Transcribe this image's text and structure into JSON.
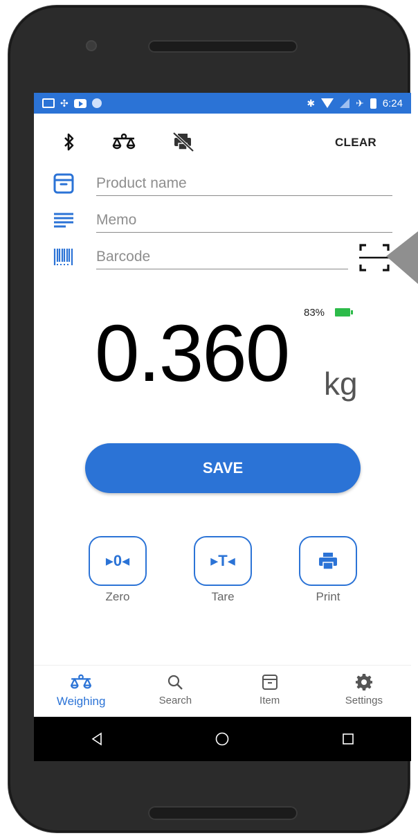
{
  "status_bar": {
    "time": "6:24",
    "icons_left": [
      "gallery-icon",
      "sync-icon",
      "youtube-icon",
      "circle-icon"
    ],
    "icons_right": [
      "bluetooth-icon",
      "wifi-icon",
      "signal-icon",
      "airplane-icon",
      "battery-icon"
    ]
  },
  "toolbar": {
    "clear_label": "CLEAR",
    "icons": [
      "bluetooth-icon",
      "scale-icon",
      "printer-off-icon"
    ]
  },
  "fields": {
    "product_name": {
      "placeholder": "Product name",
      "value": ""
    },
    "memo": {
      "placeholder": "Memo",
      "value": ""
    },
    "barcode": {
      "placeholder": "Barcode",
      "value": ""
    }
  },
  "reading": {
    "battery_percent": "83%",
    "value": "0.360",
    "unit": "kg"
  },
  "save_label": "SAVE",
  "actions": [
    {
      "label": "Zero",
      "glyph": "▸0◂"
    },
    {
      "label": "Tare",
      "glyph": "▸T◂"
    },
    {
      "label": "Print",
      "glyph": "print-icon"
    }
  ],
  "nav": [
    {
      "label": "Weighing",
      "icon": "scale-icon",
      "active": true
    },
    {
      "label": "Search",
      "icon": "search-icon",
      "active": false
    },
    {
      "label": "Item",
      "icon": "item-icon",
      "active": false
    },
    {
      "label": "Settings",
      "icon": "gear-icon",
      "active": false
    }
  ],
  "colors": {
    "accent": "#2b73d6",
    "battery": "#2dbb4a",
    "phone_body": "#2b2b2b"
  }
}
